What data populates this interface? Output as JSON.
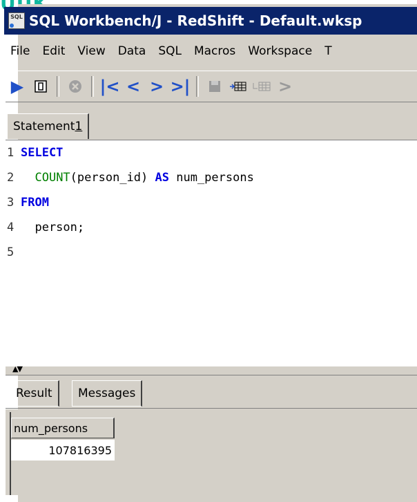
{
  "fragment_text": "UUK",
  "window": {
    "title": "SQL Workbench/J - RedShift - Default.wksp",
    "icon": "sql-app-icon"
  },
  "menu": [
    "File",
    "Edit",
    "View",
    "Data",
    "SQL",
    "Macros",
    "Workspace",
    "T"
  ],
  "toolbar": {
    "icons": [
      "run-icon",
      "run-current-icon",
      "stop-icon",
      "first-icon",
      "prev-icon",
      "next-icon",
      "last-icon",
      "save-icon",
      "insert-row-icon",
      "copy-row-icon",
      "more-icon"
    ]
  },
  "editor_tab": {
    "label_prefix": "Statement ",
    "label_num": "1"
  },
  "editor": {
    "lines": [
      {
        "n": "1",
        "parts": [
          {
            "t": "SELECT",
            "c": "kw"
          }
        ]
      },
      {
        "n": "2",
        "parts": [
          {
            "t": "  ",
            "c": ""
          },
          {
            "t": "COUNT",
            "c": "fn"
          },
          {
            "t": "(person_id) ",
            "c": ""
          },
          {
            "t": "AS",
            "c": "kw"
          },
          {
            "t": " num_persons",
            "c": ""
          }
        ]
      },
      {
        "n": "3",
        "parts": [
          {
            "t": "FROM",
            "c": "kw"
          }
        ]
      },
      {
        "n": "4",
        "parts": [
          {
            "t": "  person;",
            "c": ""
          }
        ]
      },
      {
        "n": "5",
        "parts": []
      }
    ]
  },
  "result_tabs": [
    "Result",
    "Messages"
  ],
  "result": {
    "column": "num_persons",
    "value": "107816395"
  },
  "colors": {
    "title_bar": "#0a246a",
    "keyword": "#0000e0",
    "function": "#008000",
    "toolbar_blue": "#2050c8"
  }
}
